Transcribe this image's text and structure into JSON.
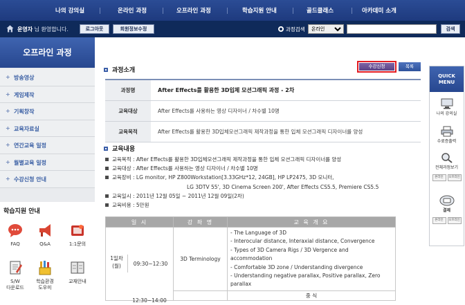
{
  "nav": {
    "items": [
      "나의 강의실",
      "온라인 과정",
      "오프라인 과정",
      "학습지원 안내",
      "골드클래스",
      "아카데미 소개"
    ]
  },
  "userbar": {
    "user_name": "운영자",
    "welcome_suffix": "님 환영합니다.",
    "logout_label": "로그아웃",
    "edit_profile_label": "회원정보수정",
    "search_label": "과정검색",
    "search_select_value": "온라인",
    "search_input_value": "",
    "search_button_label": "검색"
  },
  "sidebar": {
    "title": "오프라인 과정",
    "items": [
      {
        "label": "방송영상"
      },
      {
        "label": "게임제작"
      },
      {
        "label": "기획창작"
      },
      {
        "label": "교육자료실"
      },
      {
        "label": "연간교육 일정"
      },
      {
        "label": "월별교육 일정"
      },
      {
        "label": "수강신청 안내"
      }
    ],
    "support_title": "학습지원 안내",
    "support_items": [
      {
        "label": "FAQ",
        "icon": "speech-bubble-icon"
      },
      {
        "label": "Q&A",
        "icon": "megaphone-icon"
      },
      {
        "label": "1:1문의",
        "icon": "mail-icon"
      },
      {
        "label": "S/W\n다운로드",
        "icon": "notepad-icon"
      },
      {
        "label": "학습환경\n도우미",
        "icon": "pencil-cup-icon"
      },
      {
        "label": "교재안내",
        "icon": "book-icon"
      }
    ]
  },
  "main": {
    "section1_title": "과정소개",
    "apply_button": "수강신청",
    "list_button": "목록",
    "info": [
      {
        "label": "과정명",
        "value": "After Effects를 활용한 3D입체 모션그래픽 과정 - 2차"
      },
      {
        "label": "교육대상",
        "value": "After Effects를 사용하는 영상 디자이너 / 차수별 10명"
      },
      {
        "label": "교육목적",
        "value": "After Effects를 활용한 3D입체모션그래픽 제작과정을 통한 입체 모션그래픽 디자이너를 양성"
      }
    ],
    "section2_title": "교육내용",
    "details": [
      "교육목적 : After Effects를 활용한 3D입체모션그래픽 제작과정을 통한 입체 모션그래픽 디자이너를 양성",
      "교육대상 : After Effects를 사용하는 영상 디자이너 / 차수별 10명",
      "교육장비 : LG monitor, HP Z800Workstation[3.33GHz*12, 24GB], HP LP2475, 3D 모니터,",
      "LG 3DTV 55', 3D Cinema Screen 200', After Effects CS5.5, Premiere CS5.5",
      "교육일시 : 2011년 12월 05일 ~ 2011년 12월 09일(2차)",
      "교육비용 : 5만원"
    ],
    "schedule": {
      "headers": [
        "일 시",
        "강 좌 명",
        "교 육 개 요"
      ],
      "day": "1일차\n(월)",
      "rows": [
        {
          "time": "09:30~12:30",
          "course": "3D Terminology",
          "overview": [
            "- The Language of 3D",
            "- Interocular distance, Interaxial distance, Convergence",
            "- Types of 3D Camera Rigs / 3D Vergence and",
            "accommodation",
            "- Comfortable 3D zone / Understanding divergence",
            "- Understanding negative parallax, Positive parallax, Zero",
            "parallax"
          ]
        },
        {
          "time": "12:30~14:00",
          "course": "",
          "overview": [
            "중 식"
          ]
        }
      ]
    }
  },
  "quick_menu": {
    "title_line1": "QUICK",
    "title_line2": "MENU",
    "items": [
      {
        "label": "나의 강의실",
        "icon": "monitor-icon"
      },
      {
        "label": "수료증출력",
        "icon": "printer-icon"
      },
      {
        "label": "전체과정보기",
        "icon": "magnifier-icon"
      },
      {
        "label": "결제",
        "icon": "card-icon"
      }
    ],
    "mini_online": "온라인",
    "mini_offline": "오프라인"
  }
}
